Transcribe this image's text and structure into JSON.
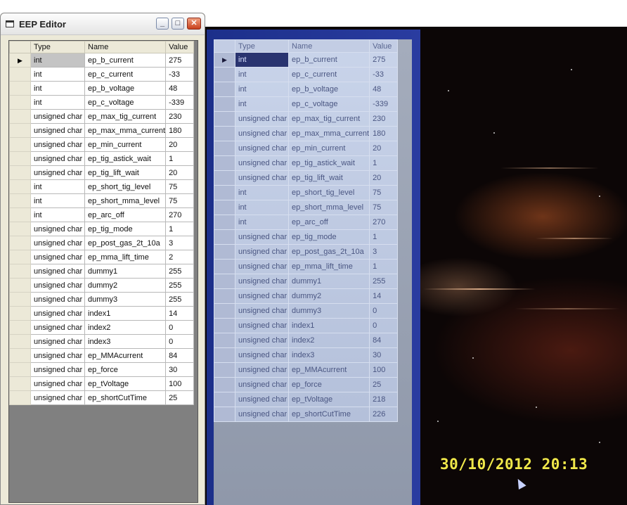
{
  "window": {
    "title": "EEP Editor",
    "controls": {
      "minimize": "_",
      "maximize": "□",
      "close": "✕"
    }
  },
  "grid": {
    "columns": [
      "Type",
      "Name",
      "Value"
    ],
    "selected_row_indicator": "▶",
    "rows": [
      {
        "type": "int",
        "name": "ep_b_current",
        "value": "275"
      },
      {
        "type": "int",
        "name": "ep_c_current",
        "value": "-33"
      },
      {
        "type": "int",
        "name": "ep_b_voltage",
        "value": "48"
      },
      {
        "type": "int",
        "name": "ep_c_voltage",
        "value": "-339"
      },
      {
        "type": "unsigned char",
        "name": "ep_max_tig_current",
        "value": "230"
      },
      {
        "type": "unsigned char",
        "name": "ep_max_mma_current",
        "value": "180"
      },
      {
        "type": "unsigned char",
        "name": "ep_min_current",
        "value": "20"
      },
      {
        "type": "unsigned char",
        "name": "ep_tig_astick_wait",
        "value": "1"
      },
      {
        "type": "unsigned char",
        "name": "ep_tig_lift_wait",
        "value": "20"
      },
      {
        "type": "int",
        "name": "ep_short_tig_level",
        "value": "75"
      },
      {
        "type": "int",
        "name": "ep_short_mma_level",
        "value": "75"
      },
      {
        "type": "int",
        "name": "ep_arc_off",
        "value": "270"
      },
      {
        "type": "unsigned char",
        "name": "ep_tig_mode",
        "value": "1"
      },
      {
        "type": "unsigned char",
        "name": "ep_post_gas_2t_10a",
        "value": "3"
      },
      {
        "type": "unsigned char",
        "name": "ep_mma_lift_time",
        "value": "2"
      },
      {
        "type": "unsigned char",
        "name": "dummy1",
        "value": "255"
      },
      {
        "type": "unsigned char",
        "name": "dummy2",
        "value": "255"
      },
      {
        "type": "unsigned char",
        "name": "dummy3",
        "value": "255"
      },
      {
        "type": "unsigned char",
        "name": "index1",
        "value": "14"
      },
      {
        "type": "unsigned char",
        "name": "index2",
        "value": "0"
      },
      {
        "type": "unsigned char",
        "name": "index3",
        "value": "0"
      },
      {
        "type": "unsigned char",
        "name": "ep_MMAcurrent",
        "value": "84"
      },
      {
        "type": "unsigned char",
        "name": "ep_force",
        "value": "30"
      },
      {
        "type": "unsigned char",
        "name": "ep_tVoltage",
        "value": "100"
      },
      {
        "type": "unsigned char",
        "name": "ep_shortCutTime",
        "value": "25"
      }
    ]
  },
  "photo": {
    "grid": {
      "columns": [
        "Type",
        "Name",
        "Value"
      ],
      "rows": [
        {
          "type": "int",
          "name": "ep_b_current",
          "value": "275"
        },
        {
          "type": "int",
          "name": "ep_c_current",
          "value": "-33"
        },
        {
          "type": "int",
          "name": "ep_b_voltage",
          "value": "48"
        },
        {
          "type": "int",
          "name": "ep_c_voltage",
          "value": "-339"
        },
        {
          "type": "unsigned char",
          "name": "ep_max_tig_current",
          "value": "230"
        },
        {
          "type": "unsigned char",
          "name": "ep_max_mma_current",
          "value": "180"
        },
        {
          "type": "unsigned char",
          "name": "ep_min_current",
          "value": "20"
        },
        {
          "type": "unsigned char",
          "name": "ep_tig_astick_wait",
          "value": "1"
        },
        {
          "type": "unsigned char",
          "name": "ep_tig_lift_wait",
          "value": "20"
        },
        {
          "type": "int",
          "name": "ep_short_tig_level",
          "value": "75"
        },
        {
          "type": "int",
          "name": "ep_short_mma_level",
          "value": "75"
        },
        {
          "type": "int",
          "name": "ep_arc_off",
          "value": "270"
        },
        {
          "type": "unsigned char",
          "name": "ep_tig_mode",
          "value": "1"
        },
        {
          "type": "unsigned char",
          "name": "ep_post_gas_2t_10a",
          "value": "3"
        },
        {
          "type": "unsigned char",
          "name": "ep_mma_lift_time",
          "value": "1"
        },
        {
          "type": "unsigned char",
          "name": "dummy1",
          "value": "255"
        },
        {
          "type": "unsigned char",
          "name": "dummy2",
          "value": "14"
        },
        {
          "type": "unsigned char",
          "name": "dummy3",
          "value": "0"
        },
        {
          "type": "unsigned char",
          "name": "index1",
          "value": "0"
        },
        {
          "type": "unsigned char",
          "name": "index2",
          "value": "84"
        },
        {
          "type": "unsigned char",
          "name": "index3",
          "value": "30"
        },
        {
          "type": "unsigned char",
          "name": "ep_MMAcurrent",
          "value": "100"
        },
        {
          "type": "unsigned char",
          "name": "ep_force",
          "value": "25"
        },
        {
          "type": "unsigned char",
          "name": "ep_tVoltage",
          "value": "218"
        },
        {
          "type": "unsigned char",
          "name": "ep_shortCutTime",
          "value": "226"
        }
      ]
    },
    "timestamp": "30/10/2012 20:13"
  }
}
